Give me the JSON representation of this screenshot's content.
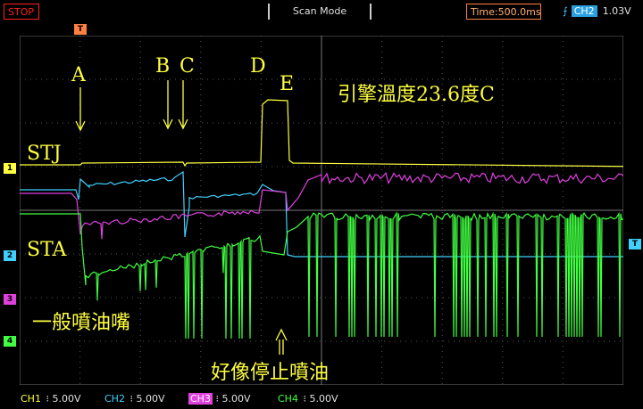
{
  "toolbar": {
    "run_state": "STOP",
    "mode": "Scan Mode",
    "timebase": "Time:500.0ms",
    "trigger_channel": "CH2",
    "trigger_level": "1.03V"
  },
  "channels": [
    {
      "id": "CH1",
      "scale": "5.00V",
      "color": "#ffff40",
      "marker": "1"
    },
    {
      "id": "CH2",
      "scale": "5.00V",
      "color": "#40d0ff",
      "marker": "2"
    },
    {
      "id": "CH3",
      "scale": "5.00V",
      "color": "#e040e0",
      "marker": "3"
    },
    {
      "id": "CH4",
      "scale": "5.00V",
      "color": "#40ff40",
      "marker": "4"
    }
  ],
  "trigger_marker": "T",
  "annotations": {
    "A": "A",
    "B": "B",
    "C": "C",
    "D": "D",
    "E": "E",
    "engine_temp": "引擎溫度23.6度C",
    "stj": "STJ",
    "sta": "STA",
    "normal_injector": "一般噴油嘴",
    "seems_stop": "好像停止噴油"
  }
}
